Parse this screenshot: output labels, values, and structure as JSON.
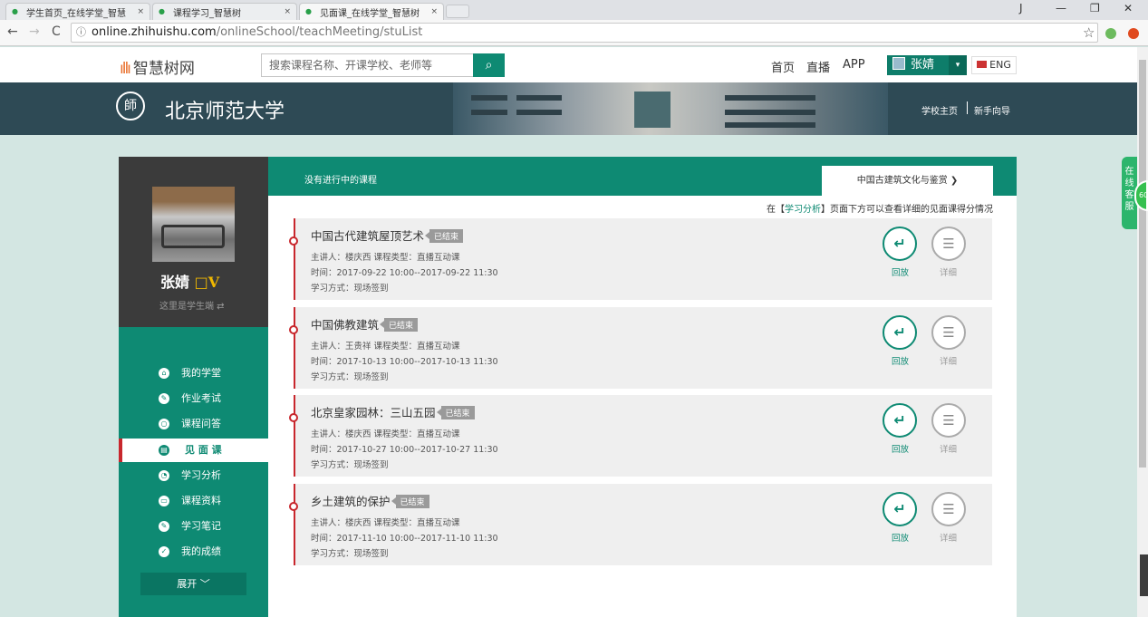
{
  "browser": {
    "tabs": [
      {
        "title": "学生首页_在线学堂_智慧",
        "close": "×",
        "active": false
      },
      {
        "title": "课程学习_智慧树",
        "close": "×",
        "active": false
      },
      {
        "title": "见面课_在线学堂_智慧树",
        "close": "×",
        "active": true
      }
    ],
    "window_controls": {
      "user": "J",
      "minimize": "—",
      "restore": "❐",
      "close": "✕"
    },
    "nav": {
      "back": "←",
      "forward": "→",
      "reload": "C"
    },
    "url_host": "online.zhihuishu.com",
    "url_path": "/onlineSchool/teachMeeting/stuList",
    "info_icon": "ⓘ",
    "star_icon": "☆"
  },
  "site": {
    "logo_text": "智慧树网",
    "search_placeholder": "搜索课程名称、开课学校、老师等",
    "search_icon": "⌕",
    "nav": [
      "首页",
      "直播",
      "APP"
    ],
    "user_name": "张婧",
    "user_dropdown": "▾",
    "lang": "ENG"
  },
  "banner": {
    "seal_text": "師",
    "university": "北京师范大学",
    "links": [
      "学校主页",
      "新手向导"
    ]
  },
  "profile": {
    "name": "张婧",
    "badge": "□V",
    "role_text": "这里是学生端 ⇄"
  },
  "menu": [
    {
      "label": "我的学堂",
      "icon": "home-icon",
      "glyph": "⌂",
      "active": false
    },
    {
      "label": "作业考试",
      "icon": "pen-icon",
      "glyph": "✎",
      "active": false
    },
    {
      "label": "课程问答",
      "icon": "chat-icon",
      "glyph": "○",
      "active": false
    },
    {
      "label": "见 面 课",
      "icon": "meeting-icon",
      "glyph": "▤",
      "active": true
    },
    {
      "label": "学习分析",
      "icon": "analysis-icon",
      "glyph": "◔",
      "active": false
    },
    {
      "label": "课程资料",
      "icon": "material-icon",
      "glyph": "▭",
      "active": false
    },
    {
      "label": "学习笔记",
      "icon": "note-icon",
      "glyph": "✎",
      "active": false
    },
    {
      "label": "我的成绩",
      "icon": "grade-icon",
      "glyph": "✓",
      "active": false
    }
  ],
  "expand_label": "展开 ﹀",
  "main": {
    "no_course_text": "没有进行中的课程",
    "course_select": "中国古建筑文化与鉴赏 ❯",
    "hint_prefix": "在【",
    "hint_link": "学习分析",
    "hint_suffix": "】页面下方可以查看详细的见面课得分情况"
  },
  "meetings": [
    {
      "title": "中国古代建筑屋顶艺术",
      "status": "已结束",
      "lecturer": "主讲人：楼庆西   课程类型：直播互动课",
      "time": "时间：2017-09-22 10:00--2017-09-22 11:30",
      "method": "学习方式：现场签到",
      "replay_label": "回放",
      "detail_label": "详细"
    },
    {
      "title": "中国佛教建筑",
      "status": "已结束",
      "lecturer": "主讲人：王贵祥   课程类型：直播互动课",
      "time": "时间：2017-10-13 10:00--2017-10-13 11:30",
      "method": "学习方式：现场签到",
      "replay_label": "回放",
      "detail_label": "详细"
    },
    {
      "title": "北京皇家园林：三山五园",
      "status": "已结束",
      "lecturer": "主讲人：楼庆西   课程类型：直播互动课",
      "time": "时间：2017-10-27 10:00--2017-10-27 11:30",
      "method": "学习方式：现场签到",
      "replay_label": "回放",
      "detail_label": "详细"
    },
    {
      "title": "乡土建筑的保护",
      "status": "已结束",
      "lecturer": "主讲人：楼庆西   课程类型：直播互动课",
      "time": "时间：2017-11-10 10:00--2017-11-10 11:30",
      "method": "学习方式：现场签到",
      "replay_label": "回放",
      "detail_label": "详细"
    }
  ],
  "service_widget": {
    "label": "在线客服",
    "badge": "60"
  },
  "colors": {
    "accent": "#0e8a73",
    "active_marker": "#c8272d",
    "badge": "#9a9a9a"
  }
}
